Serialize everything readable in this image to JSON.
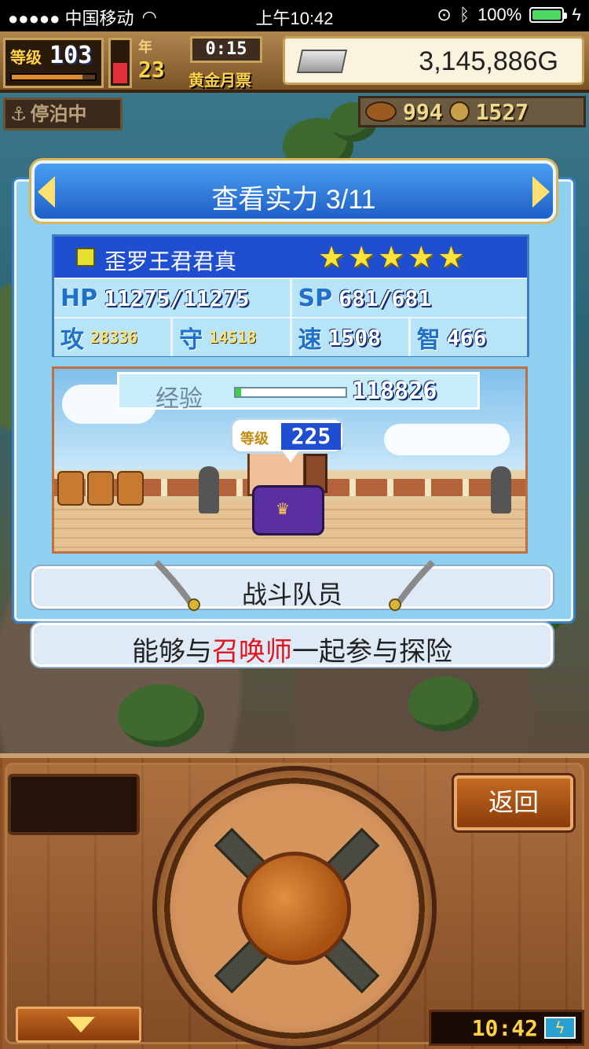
{
  "status_bar": {
    "carrier": "●●●●● 中国移动",
    "time": "上午10:42",
    "battery": "100%",
    "battery_level": 1.0
  },
  "hud": {
    "level_label": "等级",
    "level_value": "103",
    "level_progress": 0.85,
    "stamina_level": 0.55,
    "year_label": "年",
    "year_value": "23",
    "timer": "0:15",
    "month_label": "黄金月票",
    "gold": "3,145,886G",
    "docked_label": "停泊中",
    "resource_food": "994",
    "resource_coin": "1527"
  },
  "dialog": {
    "title": "查看实力 3/11",
    "name": "歪罗王君君真",
    "star_count": 5,
    "stats": {
      "hp_label": "HP",
      "hp_value": "11275/11275",
      "sp_label": "SP",
      "sp_value": "681/681",
      "atk_label": "攻",
      "atk_value": "28336",
      "def_label": "守",
      "def_value": "14518",
      "spd_label": "速",
      "spd_value": "1508",
      "int_label": "智",
      "int_value": "466"
    },
    "exp_label": "经验",
    "exp_value": "118826",
    "exp_progress": 0.05,
    "char_level_label": "等级",
    "char_level_value": "225",
    "role": "战斗队员",
    "description_pre": "能够与",
    "description_highlight": "召唤师",
    "description_post": "一起参与探险"
  },
  "panel": {
    "back_label": "返回",
    "clock": "10:42"
  },
  "colors": {
    "title_blue": "#1f5fc8",
    "highlight_red": "#e0141e",
    "star_yellow": "#ffe23a"
  }
}
